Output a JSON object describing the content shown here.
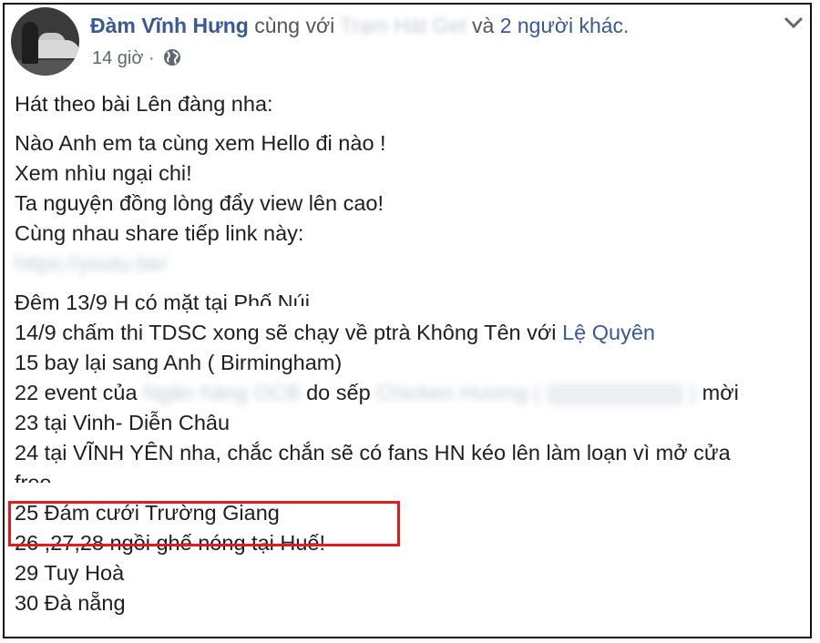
{
  "post": {
    "author": "Đàm Vĩnh Hưng",
    "with_text": "cùng với",
    "tagged_blurred": "Trạm Hát Get",
    "and_text": "và",
    "others": "2 người khác.",
    "time": "14 giờ",
    "separator": "·",
    "privacy_icon": "globe-icon",
    "options_icon": "chevron-down-icon"
  },
  "content": {
    "line1": "Hát theo bài Lên đàng nha:",
    "line2": "Nào Anh em ta cùng xem Hello đi nào !",
    "line3": "Xem nhìu ngại chi!",
    "line4": "Ta nguyện đồng lòng đẩy view lên cao!",
    "line5": "Cùng nhau share tiếp link này:",
    "link_blurred": "https://youtu.be/",
    "line6_a": "Đêm 13/9 H có mặt tại",
    "line6_b": "Phố Núi",
    "line7_a": "14/9 chấm thi TDSC xong sẽ chạy về ptrà Không Tên với",
    "line7_link": "Lệ Quyên",
    "line8": "15 bay lại sang Anh ( Birmingham)",
    "line9_a": "22 event của",
    "line9_b": "Ngân hàng OCB",
    "line9_c": "do sếp",
    "line9_d": "Chicken Hương",
    "line9_e": "(",
    "line9_g": ")",
    "line9_h": "mời",
    "line10": "23 tại Vinh- Diễn Châu",
    "line11": "24 tại VĨNH YÊN nha, chắc chắn sẽ có fans HN kéo lên làm loạn vì mở cửa",
    "line11_cont": "free",
    "line12": "25 Đám cưới Trường Giang",
    "line13": "26 ,27,28 ngồi ghế nóng tại Huế!",
    "line14": "29 Tuy Hoà",
    "line15": "30 Đà nẵng"
  },
  "highlight_color": "#e21b23"
}
